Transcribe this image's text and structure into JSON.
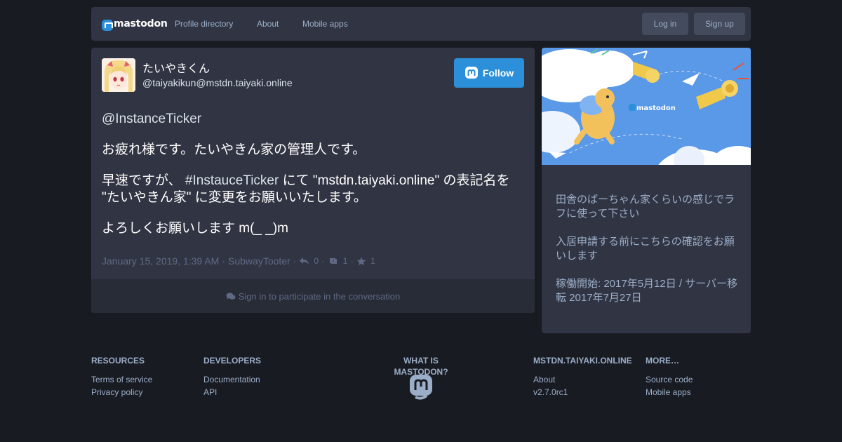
{
  "nav": {
    "brand": "mastodon",
    "links": [
      "Profile directory",
      "About",
      "Mobile apps"
    ],
    "login": "Log in",
    "signup": "Sign up"
  },
  "status": {
    "display_name": "たいやきくん",
    "acct": "@taiyakikun@mstdn.taiyaki.online",
    "follow_label": "Follow",
    "paragraphs": {
      "p1": "@InstanceTicker",
      "p2": "お疲れ様です。たいやきん家の管理人です。",
      "p3a": "早速ですが、 ",
      "p3_hashtag": "#InstauceTicker",
      "p3b": " にて \"mstdn.taiyaki.online\" の表記名を \"たいやきん家\" に変更をお願いいたします。",
      "p4": "よろしくお願いします m(_ _)m"
    },
    "date": "January 15, 2019, 1:39 AM",
    "app": "SubwayTooter",
    "replies": "0",
    "boosts": "1",
    "favourites": "1",
    "sign_in_prompt": "Sign in to participate in the conversation"
  },
  "sidebar": {
    "hero_brand": "mastodon",
    "description": [
      "田舎のばーちゃん家くらいの感じでラフに使って下さい",
      "入居申請する前にこちらの確認をお願いします",
      "稼働開始: 2017年5月12日 / サーバー移転 2017年7月27日"
    ]
  },
  "footer": {
    "resources": {
      "title": "RESOURCES",
      "links": [
        "Terms of service",
        "Privacy policy"
      ]
    },
    "developers": {
      "title": "DEVELOPERS",
      "links": [
        "Documentation",
        "API"
      ]
    },
    "what": {
      "title": "WHAT IS MASTODON?"
    },
    "instance": {
      "title": "MSTDN.TAIYAKI.ONLINE",
      "links": [
        "About",
        "v2.7.0rc1"
      ]
    },
    "more": {
      "title": "MORE…",
      "links": [
        "Source code",
        "Mobile apps"
      ]
    }
  },
  "colors": {
    "background": "#191b22",
    "panel": "#313543",
    "accent": "#2b90d9",
    "muted": "#9baec8",
    "dim": "#606984"
  },
  "icons": [
    "mastodon-logo-icon",
    "reply-icon",
    "boost-icon",
    "star-icon",
    "comments-icon"
  ]
}
